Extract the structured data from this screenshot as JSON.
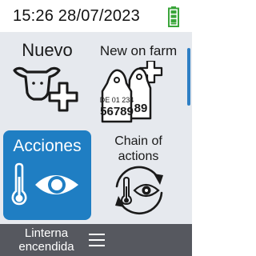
{
  "status": {
    "datetime": "15:26 28/07/2023",
    "battery_icon": "battery-full-icon",
    "battery_color": "#3aa53a"
  },
  "tiles": [
    {
      "label": "Nuevo",
      "icon": "cow-add-icon"
    },
    {
      "label": "New on farm",
      "icon": "ear-tags-add-icon",
      "tag_line1": "DE 01 234",
      "tag_number": "56789",
      "tag_partial": "89"
    },
    {
      "label": "Acciones",
      "icon": "thermometer-eye-icon",
      "active": true
    },
    {
      "label_line1": "Chain of",
      "label_line2": "actions",
      "icon": "thermometer-eye-cycle-icon"
    }
  ],
  "bottom_bar": {
    "torch_line1": "Linterna",
    "torch_line2": "encendida",
    "menu_icon": "hamburger-menu-icon"
  },
  "colors": {
    "accent": "#1f7ec3",
    "content_bg": "#e6e9ee",
    "bottom_bar": "#56585f",
    "battery": "#3aa53a"
  }
}
